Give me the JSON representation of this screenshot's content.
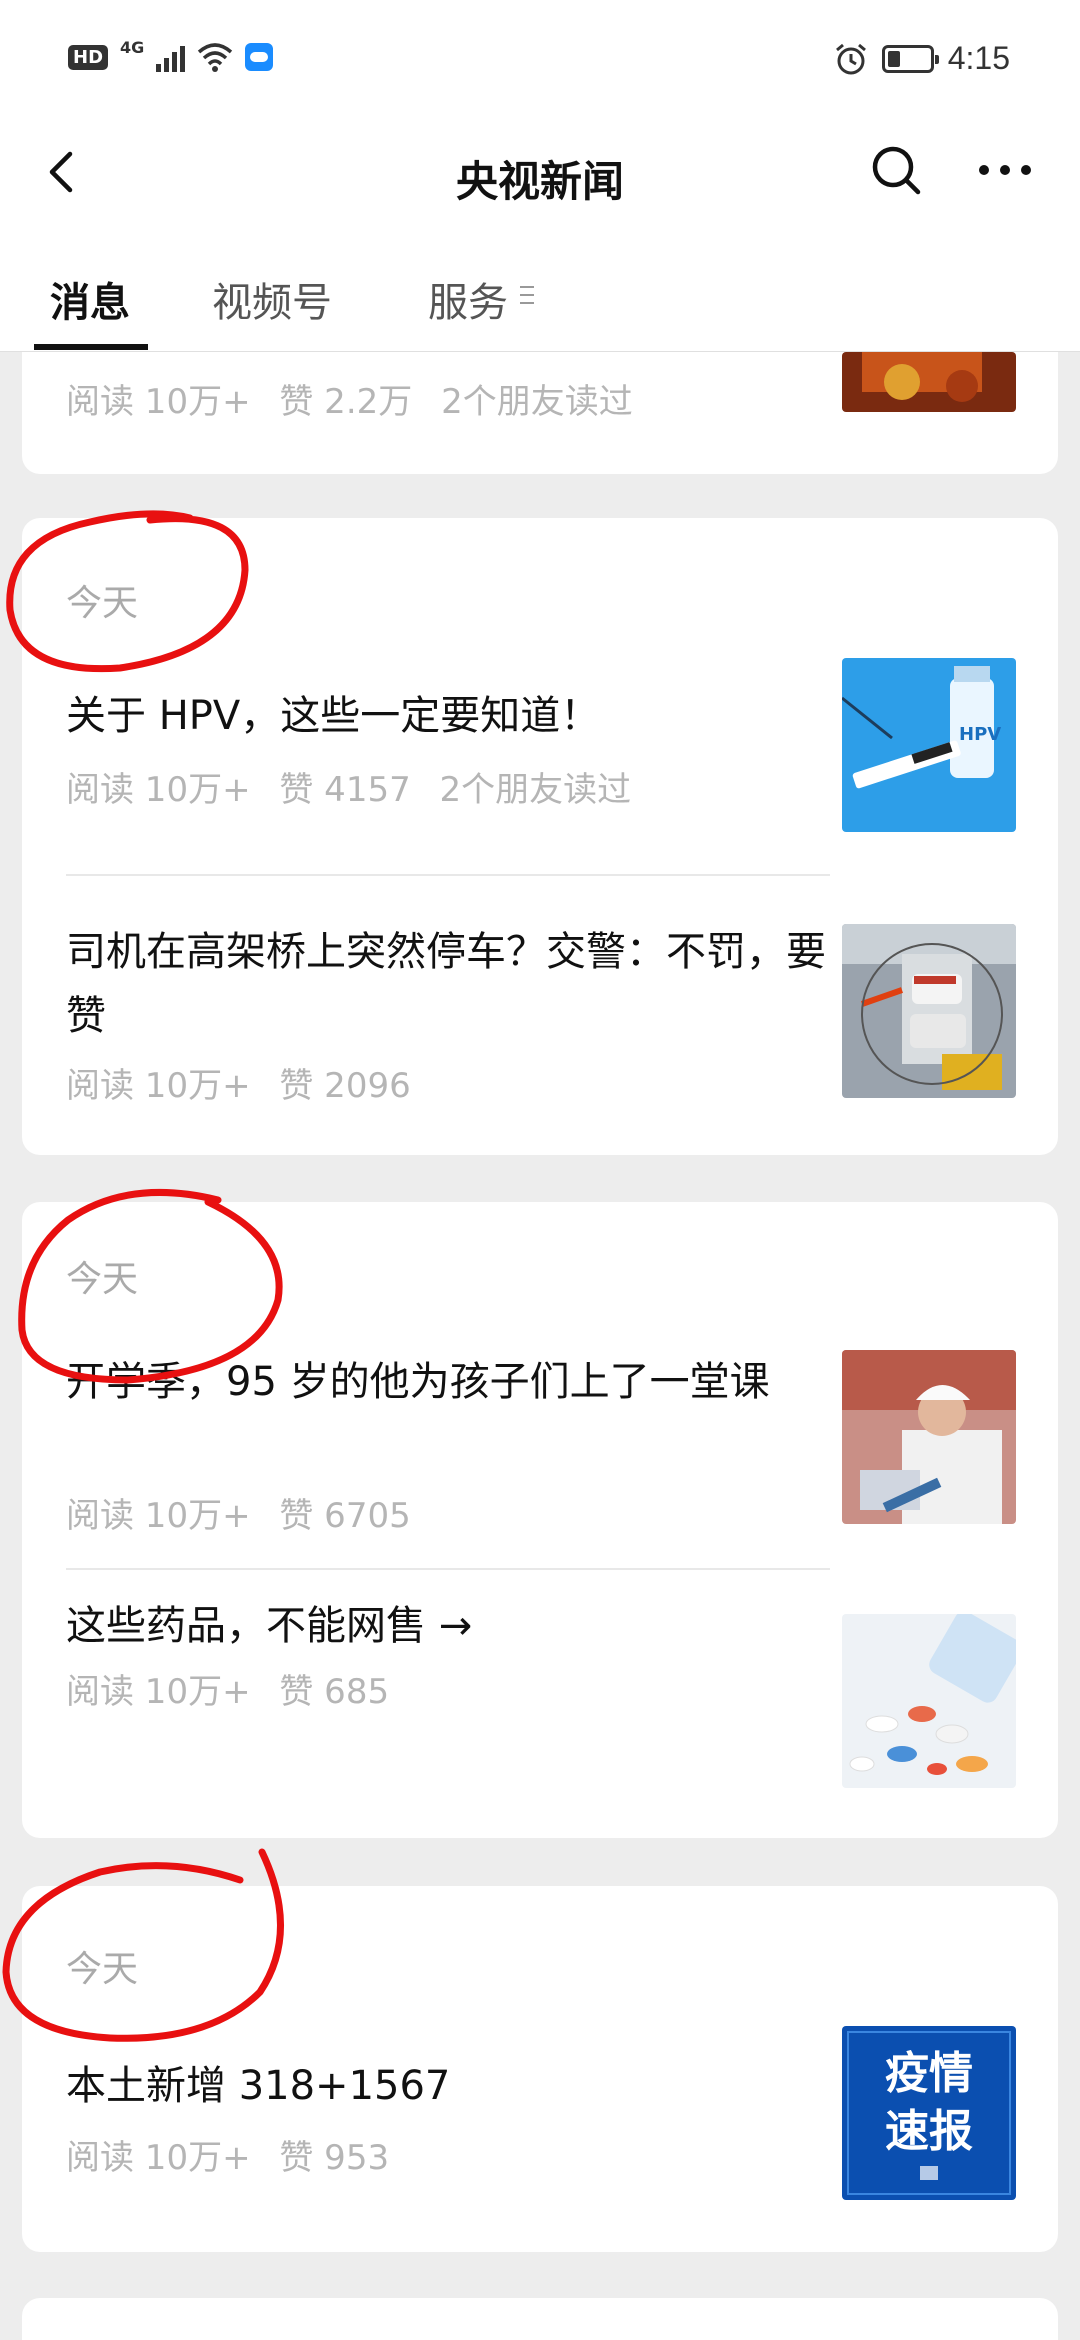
{
  "status_bar": {
    "hd": "HD",
    "network": "4G",
    "time": "4:15"
  },
  "header": {
    "title": "央视新闻",
    "back_icon": "back-arrow-icon",
    "search_icon": "search-icon",
    "more_icon": "more-dots-icon"
  },
  "tabs": [
    {
      "label": "消息",
      "active": true
    },
    {
      "label": "视频号",
      "active": false
    },
    {
      "label": "服务",
      "active": false
    }
  ],
  "top_partial": {
    "meta": {
      "reads": "阅读 10万+",
      "likes": "赞 2.2万",
      "friends": "2个朋友读过"
    }
  },
  "groups": [
    {
      "date": "今天",
      "articles": [
        {
          "title": "关于 HPV，这些一定要知道！",
          "reads": "阅读 10万+",
          "likes": "赞 4157",
          "friends": "2个朋友读过",
          "thumb_text": "HPV"
        },
        {
          "title": "司机在高架桥上突然停车？交警：不罚，要赞",
          "reads": "阅读 10万+",
          "likes": "赞 2096"
        }
      ]
    },
    {
      "date": "今天",
      "articles": [
        {
          "title": "开学季，95 岁的他为孩子们上了一堂课",
          "reads": "阅读 10万+",
          "likes": "赞 6705"
        },
        {
          "title": "这些药品，不能网售 →",
          "reads": "阅读 10万+",
          "likes": "赞 685"
        }
      ]
    },
    {
      "date": "今天",
      "articles": [
        {
          "title": "本土新增 318+1567",
          "reads": "阅读 10万+",
          "likes": "赞 953",
          "thumb_text_1": "疫情",
          "thumb_text_2": "速报"
        }
      ]
    }
  ],
  "colors": {
    "annotation": "#e81010",
    "accent_blue": "#1a8cff"
  }
}
